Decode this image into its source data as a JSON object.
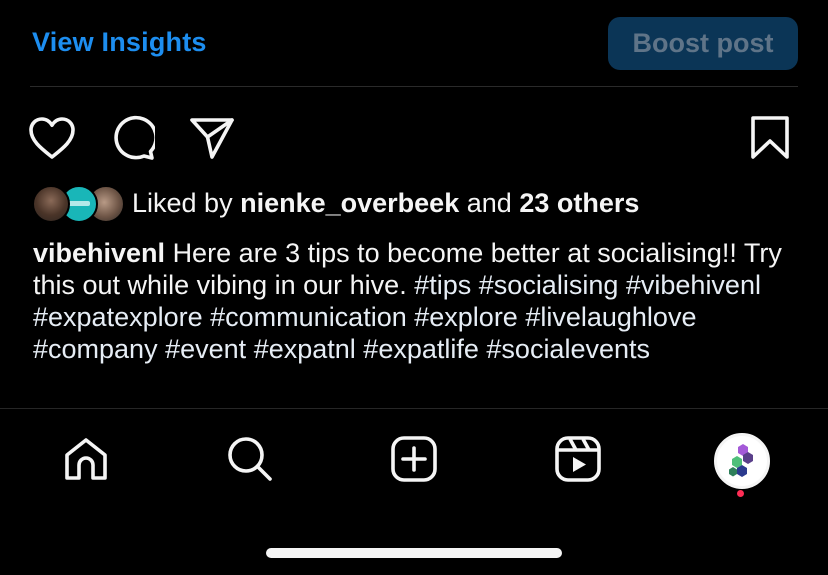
{
  "header": {
    "view_insights_label": "View Insights",
    "boost_post_label": "Boost post"
  },
  "actions": {
    "like_icon": "heart-icon",
    "comment_icon": "comment-icon",
    "share_icon": "send-icon",
    "save_icon": "bookmark-icon"
  },
  "likes": {
    "prefix": "Liked by",
    "first_user": "nienke_overbeek",
    "conjunction": "and",
    "others": "23 others"
  },
  "caption": {
    "username": "vibehivenl",
    "text": "Here are 3 tips to become better at socialising!! Try this out while vibing in our hive.",
    "hashtags": [
      "#tips",
      "#socialising",
      "#vibehivenl",
      "#expatexplore",
      "#communication",
      "#explore",
      "#livelaughlove",
      "#company",
      "#event",
      "#expatnl",
      "#expatlife",
      "#socialevents"
    ]
  },
  "tabbar": {
    "items": [
      "home-icon",
      "search-icon",
      "create-icon",
      "reels-icon",
      "profile-avatar"
    ]
  },
  "colors": {
    "background": "#000000",
    "accent": "#1d8ef0",
    "boost_button_bg": "#0b3556",
    "boost_button_text": "#5f7488",
    "notification_dot": "#ff2d55"
  }
}
